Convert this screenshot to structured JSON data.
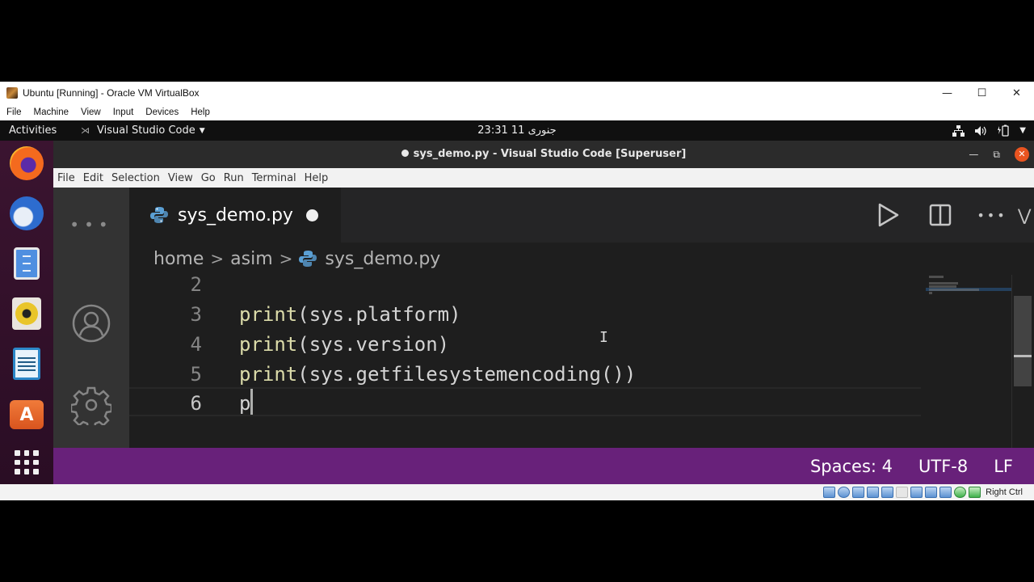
{
  "vbox": {
    "title": "Ubuntu [Running] - Oracle VM VirtualBox",
    "menu": [
      "File",
      "Machine",
      "View",
      "Input",
      "Devices",
      "Help"
    ],
    "controls": {
      "minimize": "—",
      "maximize": "☐",
      "close": "✕"
    },
    "status": {
      "host_key": "Right Ctrl"
    }
  },
  "gnome": {
    "activities": "Activities",
    "app_menu": "Visual Studio Code",
    "clock": "23:31  جنوری 11",
    "tray_icons": [
      "network-icon",
      "volume-icon",
      "battery-icon",
      "system-menu-icon"
    ],
    "dock": [
      "Firefox",
      "Thunderbird",
      "Files",
      "Rhythmbox",
      "LibreOffice Writer",
      "Ubuntu Software",
      "Show Applications"
    ]
  },
  "vscode": {
    "window_title": "sys_demo.py - Visual Studio Code [Superuser]",
    "menu": [
      "File",
      "Edit",
      "Selection",
      "View",
      "Go",
      "Run",
      "Terminal",
      "Help"
    ],
    "tab": {
      "label": "sys_demo.py",
      "dirty": true
    },
    "breadcrumbs": [
      "home",
      "asim",
      "sys_demo.py"
    ],
    "lines": [
      {
        "num": "2",
        "text": ""
      },
      {
        "num": "3",
        "fn": "print",
        "open": "(",
        "obj": "sys",
        "attr": ".platform",
        "close": ")"
      },
      {
        "num": "4",
        "fn": "print",
        "open": "(",
        "obj": "sys",
        "attr": ".version",
        "close": ")"
      },
      {
        "num": "5",
        "fn": "print",
        "open": "(",
        "obj": "sys",
        "attr": ".getfilesystemencoding()",
        "close": ")"
      },
      {
        "num": "6",
        "typed": "p"
      }
    ],
    "status": {
      "indent": "Spaces: 4",
      "encoding": "UTF-8",
      "eol": "LF"
    },
    "colors": {
      "statusbar": "#68217a",
      "editor_bg": "#1e1e1e",
      "function": "#dcdcaa",
      "close_button": "#e95420"
    }
  }
}
